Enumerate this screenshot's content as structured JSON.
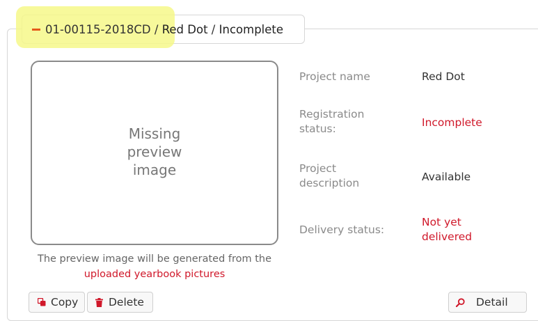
{
  "header": {
    "project_id": "01-00115-2018CD",
    "separator_1": " / ",
    "project_name": "Red Dot",
    "separator_2": " / ",
    "status": "Incomplete",
    "toggle_icon": "minus-icon",
    "colors": {
      "toggle": "#e55a1a",
      "highlight": "#f6f88a"
    }
  },
  "preview": {
    "placeholder_line1": "Missing",
    "placeholder_line2": "preview",
    "placeholder_line3": "image",
    "caption_text": "The preview image will be generated from the",
    "caption_link": "uploaded yearbook pictures"
  },
  "details": [
    {
      "label_line1": "Project name",
      "label_line2": "",
      "value_line1": "Red Dot",
      "value_line2": ""
    },
    {
      "label_line1": "Registration",
      "label_line2": "status:",
      "value_line1": "Incomplete",
      "value_line2": ""
    },
    {
      "label_line1": "Project",
      "label_line2": "description",
      "value_line1": "Available",
      "value_line2": ""
    },
    {
      "label_line1": "Delivery status:",
      "label_line2": "",
      "value_line1": "Not yet",
      "value_line2": "delivered"
    }
  ],
  "actions": {
    "copy_label": "Copy",
    "copy_icon": "copy-icon",
    "delete_label": "Delete",
    "delete_icon": "trash-icon",
    "detail_label": "Detail",
    "detail_icon": "search-icon"
  },
  "colors": {
    "accent_red": "#d0182a",
    "label_gray": "#8a8a8a",
    "border": "#d6d6d6"
  }
}
